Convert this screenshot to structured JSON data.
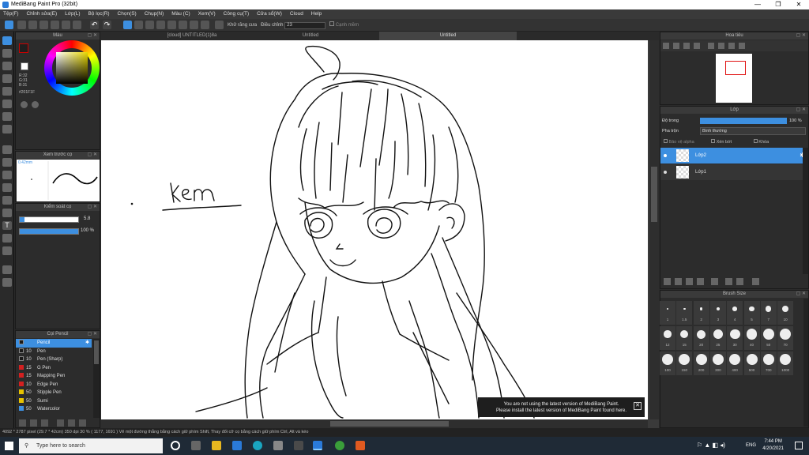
{
  "window": {
    "title": "MediBang Paint Pro (32bit)"
  },
  "menu": [
    "Tệp(F)",
    "Chỉnh sửa(E)",
    "Lớp(L)",
    "Bộ lọc(R)",
    "Chọn(S)",
    "Chụp(N)",
    "Màu (C)",
    "Xem(V)",
    "Công cụ(T)",
    "Cửa sổ(W)",
    "Cloud",
    "Help"
  ],
  "toolbar": {
    "antialias": "Khử răng cưa",
    "correction_label": "Điều chỉnh",
    "correction_value": "23",
    "snap": "Cạnh mềm"
  },
  "tabs": [
    "[cloud] UNTITLED(1)8a",
    "Untitled",
    "Untitled"
  ],
  "color_panel": {
    "title": "Màu",
    "r": "R:32",
    "g": "G:31",
    "b": "B:31",
    "hex": "#201F1F"
  },
  "brush_preview": {
    "title": "Xem trước cọ",
    "size": "0.42mm"
  },
  "brush_control": {
    "title": "Kiểm soát cọ",
    "size": "5.8",
    "opacity": "100 %"
  },
  "brush_list": {
    "title": "Cọi Pencil",
    "items": [
      {
        "size": "",
        "name": "Pencil",
        "color": "#1a1a1a",
        "selected": true
      },
      {
        "size": "10",
        "name": "Pen",
        "color": "#1a1a1a"
      },
      {
        "size": "10",
        "name": "Pen (Sharp)",
        "color": "#1a1a1a"
      },
      {
        "size": "15",
        "name": "G Pen",
        "color": "#d42020"
      },
      {
        "size": "15",
        "name": "Mapping Pen",
        "color": "#d42020"
      },
      {
        "size": "10",
        "name": "Edge Pen",
        "color": "#d42020"
      },
      {
        "size": "50",
        "name": "Stipple Pen",
        "color": "#e6c200"
      },
      {
        "size": "50",
        "name": "Sumi",
        "color": "#e6c200"
      },
      {
        "size": "50",
        "name": "Watercolor",
        "color": "#3d8fe0"
      }
    ]
  },
  "canvas": {
    "text": "Kem"
  },
  "navigator": {
    "title": "Hoa tiêu"
  },
  "layers": {
    "title": "Lớp",
    "opacity_label": "Độ trong",
    "opacity_value": "100 %",
    "blend_label": "Pha trộn",
    "blend_value": "Bình thường",
    "protect_alpha": "Bảo vệ alpha",
    "clipping": "Xén bớt",
    "lock": "Khóa",
    "items": [
      {
        "name": "Lớp2",
        "selected": true
      },
      {
        "name": "Lớp1",
        "selected": false
      }
    ]
  },
  "brush_size": {
    "title": "Brush Size",
    "labels": [
      "1",
      "1.5",
      "2",
      "3",
      "4",
      "5",
      "7",
      "10",
      "12",
      "15",
      "20",
      "25",
      "30",
      "40",
      "50",
      "70",
      "100",
      "150",
      "200",
      "300",
      "400",
      "500",
      "700",
      "1000"
    ]
  },
  "toast": {
    "line1": "You are not using the latest version of MediBang Paint.",
    "line2": "Please install the latest version of MediBang Paint found here."
  },
  "status": "4092 * 2787 pixel  (29.7 * 42cm)  350 dpi  30 %  ( 1177, 1691 )  Vẽ một đường thẳng bằng cách giữ phím Shift, Thay đổi cỡ cọ bằng cách giữ phím Ctrl, Alt và kéo",
  "taskbar": {
    "search": "Type here to search",
    "lang": "ENG",
    "time": "7:44 PM",
    "date": "4/20/2021"
  }
}
